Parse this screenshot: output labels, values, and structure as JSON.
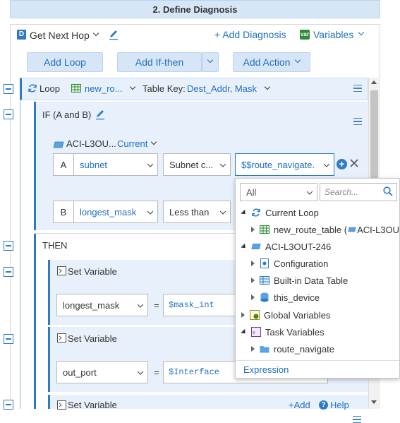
{
  "step_header": "2. Define Diagnosis",
  "toolbar": {
    "badge": "D",
    "diagnosis_name": "Get Next Hop",
    "add_diagnosis": "+ Add Diagnosis",
    "variables_badge": "var",
    "variables": "Variables"
  },
  "buttons": {
    "add_loop": "Add Loop",
    "add_if_then": "Add If-then",
    "add_action": "Add Action"
  },
  "loop": {
    "label": "Loop",
    "table": "new_ro...",
    "table_key_label": "Table Key:",
    "table_key_value": "Dest_Addr, Mask"
  },
  "if_block": {
    "label": "IF (A and B)",
    "device": "ACI-L3OU...",
    "device_scope": "Current",
    "row_a": {
      "letter": "A",
      "field": "subnet",
      "operator": "Subnet c...",
      "value": "$$route_navigate."
    },
    "row_b": {
      "letter": "B",
      "field": "longest_mask",
      "operator": "Less than"
    }
  },
  "then_label": "THEN",
  "set_variable_1": {
    "title": "Set Variable",
    "variable": "longest_mask",
    "eq": "=",
    "value": "$mask_int"
  },
  "set_variable_2": {
    "title": "Set Variable",
    "variable": "out_port",
    "eq": "=",
    "value": "$Interface"
  },
  "set_variable_3": {
    "title": "Set Variable",
    "add": "+Add",
    "help": "Help"
  },
  "dropdown": {
    "scope_select": "All",
    "search_placeholder": "Search...",
    "items": [
      {
        "label": "Current Loop",
        "icon": "loop-icon",
        "expanded": true
      },
      {
        "label": "new_route_table (",
        "suffix": "ACI-L3OU",
        "icon": "table-icon",
        "expanded": false
      },
      {
        "label": "ACI-L3OUT-246",
        "icon": "device-icon",
        "expanded": true
      },
      {
        "label": "Configuration",
        "icon": "config-icon",
        "expanded": false
      },
      {
        "label": "Built-in Data Table",
        "icon": "grid-table-icon",
        "expanded": false
      },
      {
        "label": "this_device",
        "icon": "database-icon",
        "expanded": false
      },
      {
        "label": "Global Variables",
        "icon": "global-vars-icon",
        "expanded": false
      },
      {
        "label": "Task Variables",
        "icon": "task-vars-icon",
        "expanded": true
      },
      {
        "label": "route_navigate",
        "icon": "folder-icon",
        "expanded": false
      }
    ],
    "expression": "Expression"
  },
  "colors": {
    "accent": "#1f6fbf",
    "panel": "#e8f1fb",
    "header": "#d6e6f7"
  }
}
